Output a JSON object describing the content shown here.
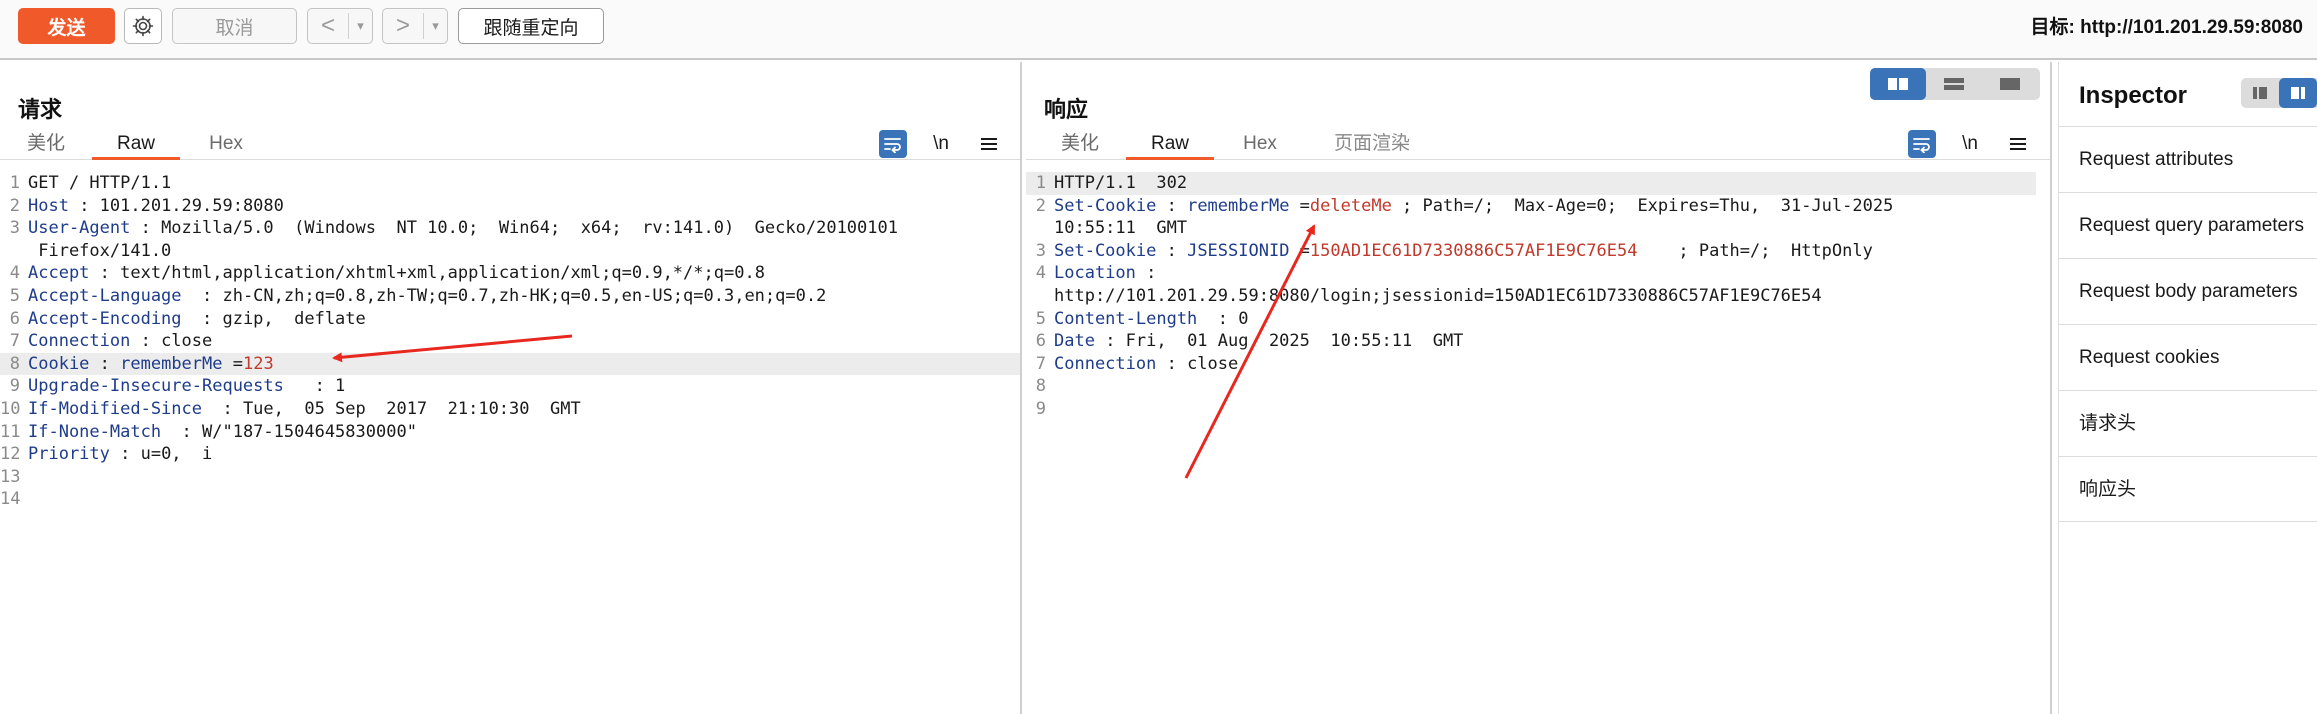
{
  "toolbar": {
    "send_label": "发送",
    "cancel_label": "取消",
    "back_label": "<",
    "forward_label": ">",
    "dropdown_label": "▾",
    "follow_redirect_label": "跟随重定向",
    "target_label": "目标: http://101.201.29.59:8080"
  },
  "request": {
    "title": "请求",
    "tabs": [
      "美化",
      "Raw",
      "Hex"
    ],
    "active_tab": "Raw",
    "newline_label": "\\n",
    "lines": [
      {
        "n": "1",
        "parts": [
          {
            "t": "GET / HTTP/1.1",
            "c": ""
          }
        ]
      },
      {
        "n": "2",
        "parts": [
          {
            "t": "Host",
            "c": "k"
          },
          {
            "t": " : 101.201.29.59:8080",
            "c": ""
          }
        ]
      },
      {
        "n": "3",
        "parts": [
          {
            "t": "User-Agent",
            "c": "k"
          },
          {
            "t": " : Mozilla/5.0  (Windows  NT 10.0;  Win64;  x64;  rv:141.0)  Gecko/20100101",
            "c": ""
          }
        ]
      },
      {
        "n": "",
        "parts": [
          {
            "t": " Firefox/141.0",
            "c": ""
          }
        ]
      },
      {
        "n": "4",
        "parts": [
          {
            "t": "Accept",
            "c": "k"
          },
          {
            "t": " : text/html,application/xhtml+xml,application/xml;q=0.9,*/*;q=0.8",
            "c": ""
          }
        ]
      },
      {
        "n": "5",
        "parts": [
          {
            "t": "Accept-Language",
            "c": "k"
          },
          {
            "t": "  : zh-CN,zh;q=0.8,zh-TW;q=0.7,zh-HK;q=0.5,en-US;q=0.3,en;q=0.2",
            "c": ""
          }
        ]
      },
      {
        "n": "6",
        "parts": [
          {
            "t": "Accept-Encoding",
            "c": "k"
          },
          {
            "t": "  : gzip,  deflate",
            "c": ""
          }
        ]
      },
      {
        "n": "7",
        "parts": [
          {
            "t": "Connection",
            "c": "k"
          },
          {
            "t": " : close",
            "c": ""
          }
        ]
      },
      {
        "n": "8",
        "hl": true,
        "parts": [
          {
            "t": "Cookie",
            "c": "k"
          },
          {
            "t": " : ",
            "c": ""
          },
          {
            "t": "rememberMe",
            "c": "k"
          },
          {
            "t": " =",
            "c": ""
          },
          {
            "t": "123",
            "c": "v-red"
          }
        ]
      },
      {
        "n": "9",
        "parts": [
          {
            "t": "Upgrade-Insecure-Requests",
            "c": "k"
          },
          {
            "t": "   : 1",
            "c": ""
          }
        ]
      },
      {
        "n": "10",
        "parts": [
          {
            "t": "If-Modified-Since",
            "c": "k"
          },
          {
            "t": "  : Tue,  05 Sep  2017  21:10:30  GMT",
            "c": ""
          }
        ]
      },
      {
        "n": "11",
        "parts": [
          {
            "t": "If-None-Match",
            "c": "k"
          },
          {
            "t": "  : W/\"187-1504645830000\"",
            "c": ""
          }
        ]
      },
      {
        "n": "12",
        "parts": [
          {
            "t": "Priority",
            "c": "k"
          },
          {
            "t": " : u=0,  i",
            "c": ""
          }
        ]
      },
      {
        "n": "13",
        "parts": [
          {
            "t": "",
            "c": ""
          }
        ]
      },
      {
        "n": "14",
        "parts": [
          {
            "t": "",
            "c": ""
          }
        ]
      }
    ]
  },
  "response": {
    "title": "响应",
    "tabs": [
      "美化",
      "Raw",
      "Hex",
      "页面渲染"
    ],
    "active_tab": "Raw",
    "newline_label": "\\n",
    "lines": [
      {
        "n": "1",
        "hl": true,
        "parts": [
          {
            "t": "HTTP/1.1  302",
            "c": ""
          }
        ]
      },
      {
        "n": "2",
        "parts": [
          {
            "t": "Set-Cookie",
            "c": "k"
          },
          {
            "t": " : ",
            "c": ""
          },
          {
            "t": "rememberMe",
            "c": "k"
          },
          {
            "t": " =",
            "c": ""
          },
          {
            "t": "deleteMe",
            "c": "v-red"
          },
          {
            "t": " ; Path=/;  Max-Age=0;  Expires=Thu,  31-Jul-2025",
            "c": ""
          }
        ]
      },
      {
        "n": "",
        "parts": [
          {
            "t": "10:55:11  GMT",
            "c": ""
          }
        ]
      },
      {
        "n": "3",
        "parts": [
          {
            "t": "Set-Cookie",
            "c": "k"
          },
          {
            "t": " : ",
            "c": ""
          },
          {
            "t": "JSESSIONID",
            "c": "k"
          },
          {
            "t": " =",
            "c": ""
          },
          {
            "t": "150AD1EC61D7330886C57AF1E9C76E54",
            "c": "v-red"
          },
          {
            "t": "    ; Path=/;  HttpOnly",
            "c": ""
          }
        ]
      },
      {
        "n": "4",
        "parts": [
          {
            "t": "Location",
            "c": "k"
          },
          {
            "t": " :",
            "c": ""
          }
        ]
      },
      {
        "n": "",
        "parts": [
          {
            "t": "http://101.201.29.59:8080/login;jsessionid=150AD1EC61D7330886C57AF1E9C76E54",
            "c": ""
          }
        ]
      },
      {
        "n": "5",
        "parts": [
          {
            "t": "Content-Length",
            "c": "k"
          },
          {
            "t": "  : 0",
            "c": ""
          }
        ]
      },
      {
        "n": "6",
        "parts": [
          {
            "t": "Date",
            "c": "k"
          },
          {
            "t": " : Fri,  01 Aug  2025  10:55:11  GMT",
            "c": ""
          }
        ]
      },
      {
        "n": "7",
        "parts": [
          {
            "t": "Connection",
            "c": "k"
          },
          {
            "t": " : close",
            "c": ""
          }
        ]
      },
      {
        "n": "8",
        "parts": [
          {
            "t": "",
            "c": ""
          }
        ]
      },
      {
        "n": "9",
        "parts": [
          {
            "t": "",
            "c": ""
          }
        ]
      }
    ]
  },
  "inspector": {
    "title": "Inspector",
    "items": [
      "Request attributes",
      "Request query parameters",
      "Request body parameters",
      "Request cookies",
      "请求头",
      "响应头"
    ]
  },
  "colors": {
    "accent": "#f0592a",
    "blue": "#3a73b8",
    "key": "#1e3c8a",
    "value_red": "#c0392b",
    "annotation_arrow": "#e8281e"
  },
  "icons": {
    "settings": "gear-icon",
    "wrap": "word-wrap-icon",
    "menu": "menu-icon",
    "layout": [
      "split-horizontal-icon",
      "split-vertical-icon",
      "single-pane-icon"
    ]
  }
}
